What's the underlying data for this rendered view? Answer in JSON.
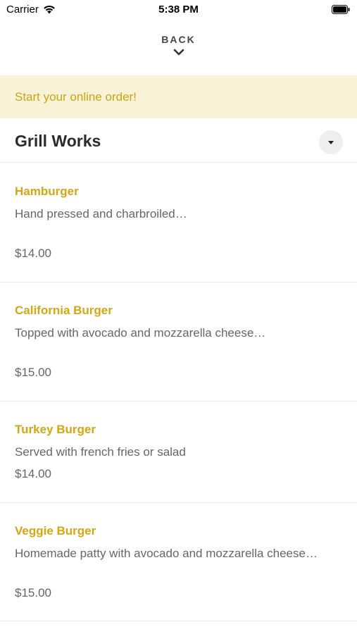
{
  "status_bar": {
    "carrier": "Carrier",
    "time": "5:38 PM",
    "wifi_icon": "wifi-icon",
    "battery_icon": "battery-icon"
  },
  "nav": {
    "back_label": "BACK",
    "chevron_icon": "chevron-down-icon"
  },
  "banner": {
    "text": "Start your online order!",
    "background": "#f8f3d6",
    "color": "#c8a416"
  },
  "section": {
    "title": "Grill Works",
    "toggle_icon": "caret-down-icon"
  },
  "accent_color": "#d4a712",
  "menu_items": [
    {
      "name": "Hamburger",
      "description": "Hand pressed and charbroiled…",
      "price": "$14.00"
    },
    {
      "name": "California Burger",
      "description": "Topped with avocado and mozzarella cheese…",
      "price": "$15.00"
    },
    {
      "name": "Turkey Burger",
      "description": "Served with french fries or salad",
      "price": "$14.00"
    },
    {
      "name": "Veggie Burger",
      "description": "Homemade patty with avocado and mozzarella cheese…",
      "price": "$15.00"
    }
  ]
}
